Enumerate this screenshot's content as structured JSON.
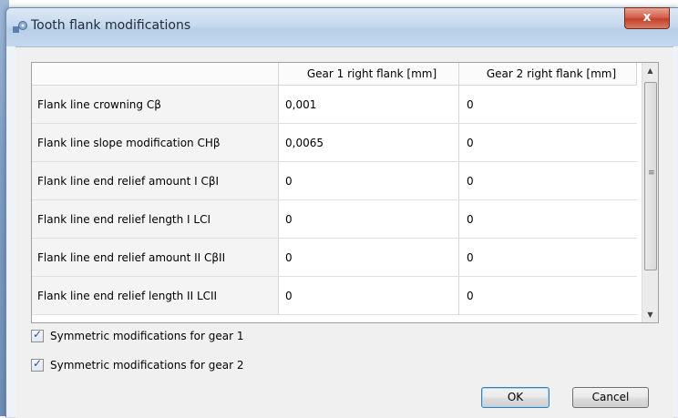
{
  "window": {
    "title": "Tooth flank modifications",
    "close_label": "x"
  },
  "table": {
    "headers": [
      "",
      "Gear 1 right flank [mm]",
      "Gear 2 right flank [mm]"
    ],
    "rows": [
      {
        "label": "Flank line crowning Cβ",
        "gear1": "0,001",
        "gear2": "0"
      },
      {
        "label": "Flank line slope modification CHβ",
        "gear1": "0,0065",
        "gear2": "0"
      },
      {
        "label": "Flank line end relief amount I CβI",
        "gear1": "0",
        "gear2": "0"
      },
      {
        "label": "Flank line end relief length I LCI",
        "gear1": "0",
        "gear2": "0"
      },
      {
        "label": "Flank line end relief amount II CβII",
        "gear1": "0",
        "gear2": "0"
      },
      {
        "label": "Flank line end relief length II LCII",
        "gear1": "0",
        "gear2": "0"
      }
    ]
  },
  "scrollbar": {
    "up_icon": "▲",
    "down_icon": "▼",
    "grip_icon": "≡"
  },
  "options": {
    "sym_gear1": {
      "label": "Symmetric modifications for gear 1",
      "checked": true
    },
    "sym_gear2": {
      "label": "Symmetric modifications for gear 2",
      "checked": true
    }
  },
  "buttons": {
    "ok": "OK",
    "cancel": "Cancel"
  }
}
